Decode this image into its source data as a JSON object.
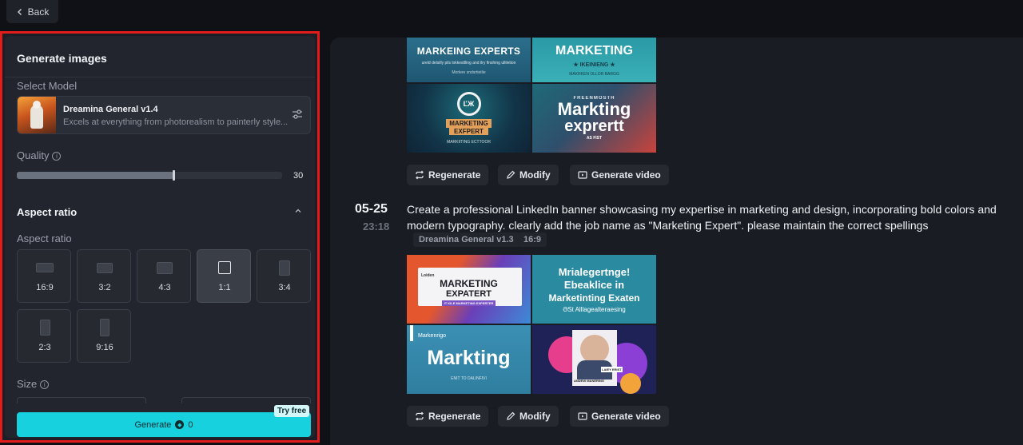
{
  "topbar": {
    "back_label": "Back"
  },
  "panel": {
    "title": "Generate images",
    "select_model_label": "Select Model",
    "model": {
      "name": "Dreamina General v1.4",
      "description": "Excels at everything from photorealism to painterly style..."
    },
    "quality_label": "Quality",
    "quality_value": "30",
    "quality_fraction": 0.59,
    "aspect_section_title": "Aspect ratio",
    "aspect_label": "Aspect ratio",
    "ratios": [
      {
        "label": "16:9",
        "selected": false
      },
      {
        "label": "3:2",
        "selected": false
      },
      {
        "label": "4:3",
        "selected": false
      },
      {
        "label": "1:1",
        "selected": true
      },
      {
        "label": "3:4",
        "selected": false
      },
      {
        "label": "2:3",
        "selected": false
      },
      {
        "label": "9:16",
        "selected": false
      }
    ],
    "size_label": "Size",
    "generate_label": "Generate",
    "generate_cost": "0",
    "try_free": "Try free"
  },
  "feed": {
    "top_result": {
      "images": [
        {
          "lines": [
            "MARKEING EXPERTS",
            "ureld delsilly pils lokkestlling and ilry finshing ulliletion",
            "Morlere sndsrtietlie"
          ]
        },
        {
          "lines": [
            "MARKETING",
            "★ IKEINIENG ★",
            "MAKRKEN OLLOR BARGG"
          ]
        },
        {
          "lines": [
            "MARKETING",
            "EXFPERT",
            "MARKIITING ECTTOOR"
          ]
        },
        {
          "lines": [
            "FREENMOSTH",
            "Markting",
            "exprertt",
            "AS FIST"
          ]
        }
      ],
      "actions": [
        "Regenerate",
        "Modify",
        "Generate video"
      ]
    },
    "entry": {
      "date": "05-25",
      "time": "23:18",
      "prompt": "Create a professional LinkedIn banner showcasing my expertise in marketing and design, incorporating bold colors and modern typography. clearly add the job name as \"Marketing Expert\". please maintain the correct spellings",
      "tags": [
        "Dreamina General v1.3",
        "16:9"
      ],
      "images": [
        {
          "lines": [
            "Loiden",
            "MARKETING",
            "EXPATERT",
            "IT KILE MARKETING EXPERTER"
          ]
        },
        {
          "lines": [
            "Mrialegertnge!",
            "Ebeaklice in",
            "Marketinting Exaten",
            "ƏSt Alllagealteraesing"
          ]
        },
        {
          "lines": [
            "Markenrigo",
            "Markting",
            "ENIT TO DALINFIVI"
          ]
        },
        {
          "lines": [
            "ANDEW MANERING",
            "LAIEY ERIST"
          ]
        }
      ],
      "actions": [
        "Regenerate",
        "Modify",
        "Generate video"
      ]
    }
  }
}
